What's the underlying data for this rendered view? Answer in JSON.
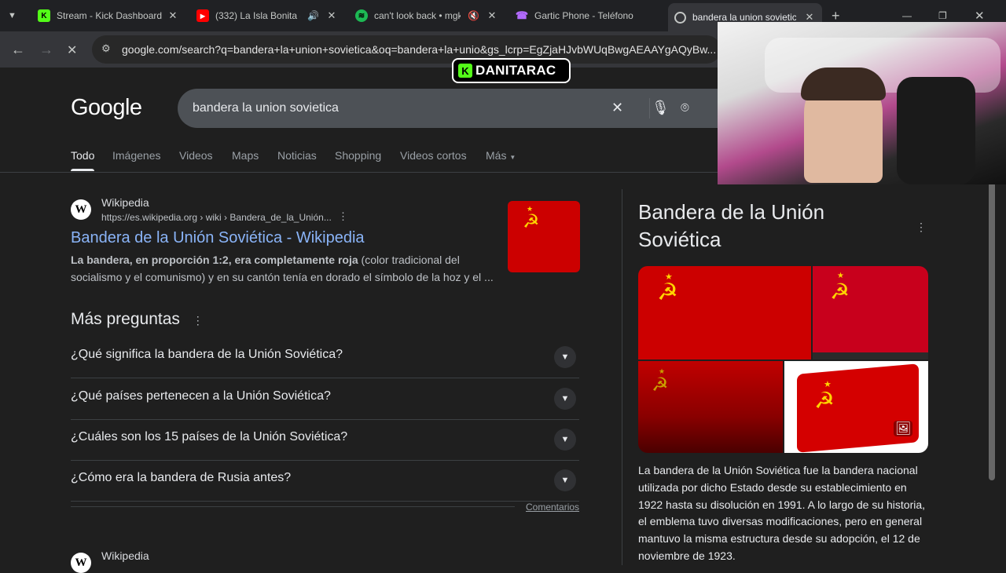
{
  "browser": {
    "tabs": [
      {
        "label": "Stream - Kick Dashboard",
        "icon": "kick-icon",
        "active": false
      },
      {
        "label": "(332) La Isla Bonita -",
        "icon": "youtube-icon",
        "active": false
      },
      {
        "label": "can't look back • mgk",
        "icon": "spotify-icon",
        "active": false
      },
      {
        "label": "Gartic Phone - Teléfono",
        "icon": "gartic-icon",
        "active": false
      },
      {
        "label": "bandera la union sovietica",
        "icon": "google-icon",
        "active": true
      }
    ],
    "url": "google.com/search?q=bandera+la+union+sovietica&oq=bandera+la+unio&gs_lcrp=EgZjaHJvbWUqBwgAEAAYgAQyBw..."
  },
  "search": {
    "logo": "Google",
    "query": "bandera la union sovietica"
  },
  "filters": [
    "Todo",
    "Imágenes",
    "Videos",
    "Maps",
    "Noticias",
    "Shopping",
    "Videos cortos",
    "Más"
  ],
  "result1": {
    "site": "Wikipedia",
    "cite": "https://es.wikipedia.org › wiki › Bandera_de_la_Unión...",
    "title": "Bandera de la Unión Soviética - Wikipedia",
    "snippet_bold": "La bandera, en proporción 1:2, era completamente roja",
    "snippet_line1_rest": " (color tradicional del",
    "snippet_line2": "socialismo y el comunismo) y en su cantón tenía en dorado el símbolo de la hoz y el ..."
  },
  "paa": {
    "title": "Más preguntas",
    "questions": [
      "¿Qué significa la bandera de la Unión Soviética?",
      "¿Qué países pertenecen a la Unión Soviética?",
      "¿Cuáles son los 15 países de la Unión Soviética?",
      "¿Cómo era la bandera de Rusia antes?"
    ],
    "feedback": "Comentarios"
  },
  "result2": {
    "site": "Wikipedia"
  },
  "knowledge_panel": {
    "title": "Bandera de la Unión Soviética",
    "description": "La bandera de la Unión Soviética fue la bandera nacional utilizada por dicho Estado desde su establecimiento en 1922 hasta su disolución en 1991. A lo largo de su historia, el emblema tuvo diversas modificaciones, pero en general mantuvo la misma estructura desde su adopción, el 12 de noviembre de 1923."
  },
  "overlay": {
    "streamer_name": "DANITARAC"
  },
  "colors": {
    "flag_red": "#cc0000",
    "emblem_gold": "#ffd400",
    "link_blue": "#8ab4f8",
    "kick_green": "#53fc18"
  }
}
